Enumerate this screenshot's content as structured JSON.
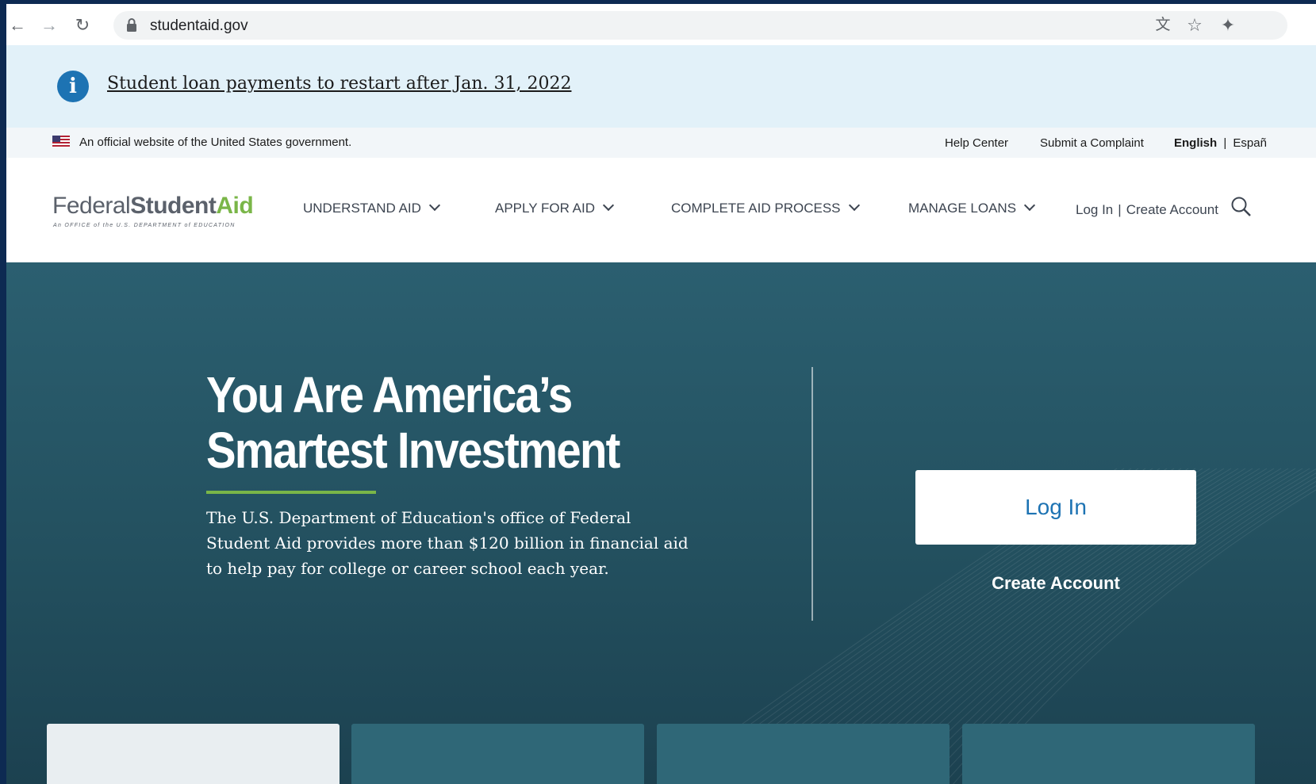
{
  "browser": {
    "url": "studentaid.gov"
  },
  "alert": {
    "message": "Student loan payments to restart after Jan. 31, 2022"
  },
  "gov_banner": {
    "official_text": "An official website of the United States government.",
    "help_center": "Help Center",
    "submit_complaint": "Submit a Complaint",
    "lang_english": "English",
    "lang_separator": "|",
    "lang_espanol": "Españ"
  },
  "logo": {
    "federal": "Federal",
    "student": "Student",
    "aid": "Aid",
    "subtitle": "An OFFICE of the U.S. DEPARTMENT of EDUCATION"
  },
  "nav": {
    "items": [
      {
        "label": "UNDERSTAND AID"
      },
      {
        "label": "APPLY FOR AID"
      },
      {
        "label": "COMPLETE AID PROCESS"
      },
      {
        "label": "MANAGE LOANS"
      }
    ],
    "log_in": "Log In",
    "separator": "|",
    "create_account": "Create Account"
  },
  "hero": {
    "headline_line1": "You Are America’s",
    "headline_line2": "Smartest Investment",
    "description": "The U.S. Department of Education's office of Federal Student Aid provides more than $120 billion in financial aid to help pay for college or career school each year.",
    "login_button": "Log In",
    "create_account": "Create Account"
  },
  "colors": {
    "accent_blue": "#1d73b3",
    "accent_green": "#7ab648",
    "hero_teal": "#23505f"
  }
}
